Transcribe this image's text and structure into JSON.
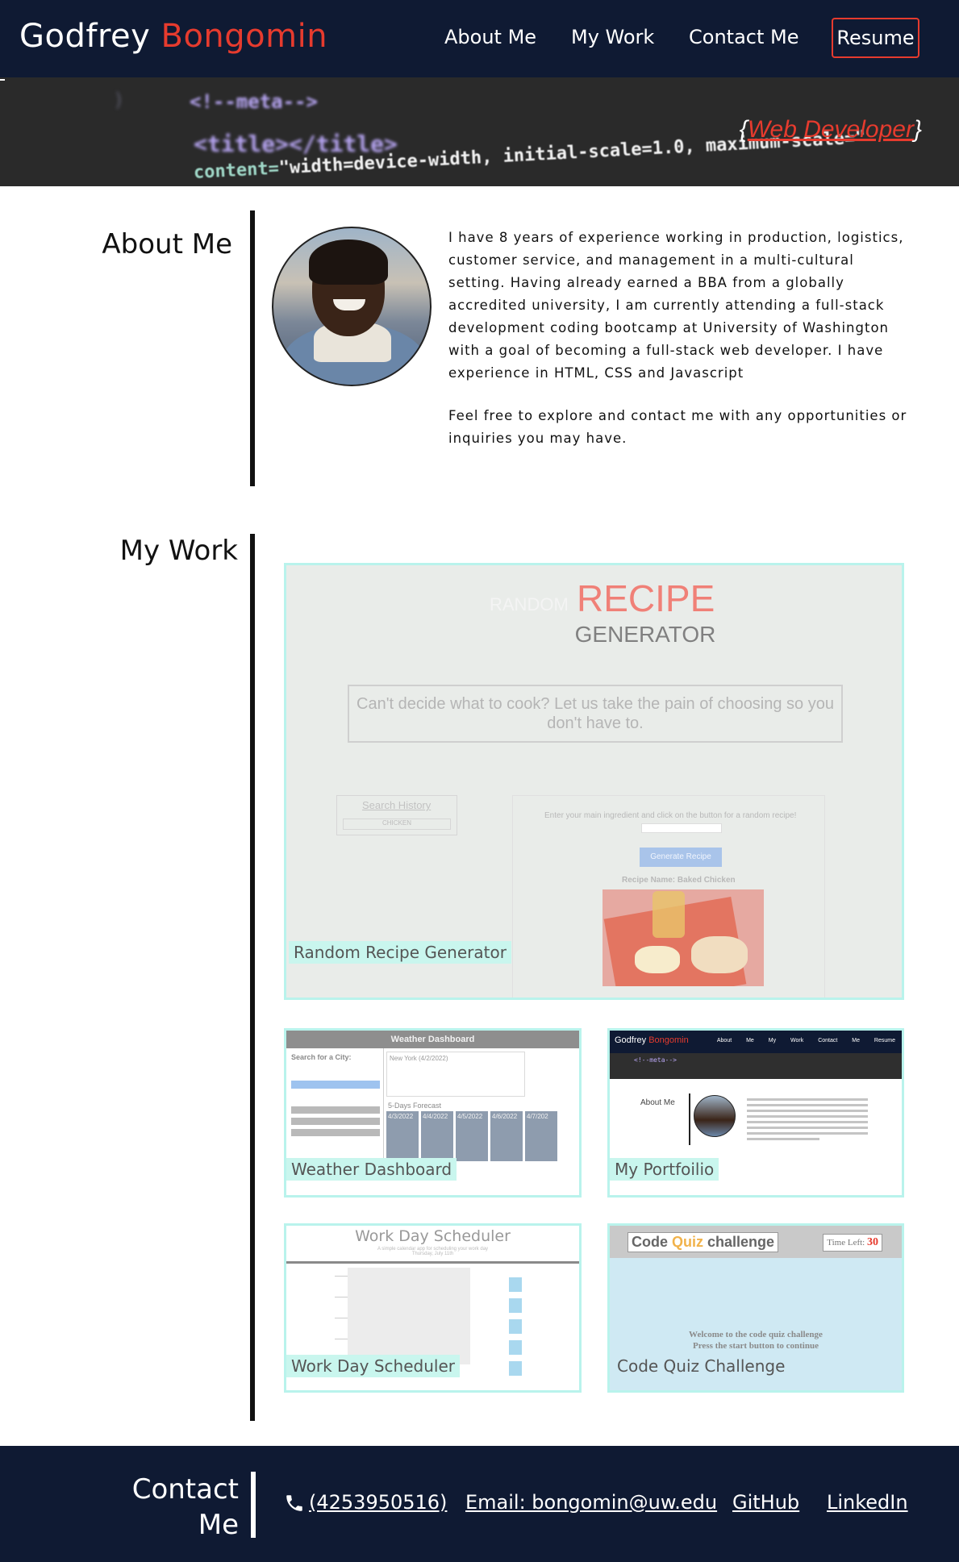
{
  "nav": {
    "brand_first": "Godfrey",
    "brand_last": "Bongomin",
    "links": [
      "About Me",
      "My Work",
      "Contact Me"
    ],
    "resume_label": "Resume"
  },
  "hero": {
    "code_line_1": "<!--meta-->",
    "code_line_2": "<title></title>",
    "code_line_3_attr": "content=",
    "code_line_3_value": "\"width=device-width, initial-scale=1.0, maximum-scale=\"",
    "tagline_open": "{",
    "tagline_text": "Web Developer",
    "tagline_close": "}"
  },
  "about": {
    "title": "About Me",
    "paragraph_1": "I have 8 years of experience working in production, logistics, customer service, and management in a multi-cultural setting. Having already earned a BBA from a globally accredited university, I am currently attending a full-stack development coding bootcamp at University of Washington with a goal of becoming a full-stack web developer. I have experience in HTML, CSS and Javascript",
    "paragraph_2": "Feel free to explore and contact me with any opportunities or inquiries you may have."
  },
  "work": {
    "title": "My Work",
    "projects": [
      {
        "label": "Random Recipe Generator"
      },
      {
        "label": "Weather Dashboard"
      },
      {
        "label": "My Portfoilio"
      },
      {
        "label": "Work Day Scheduler"
      },
      {
        "label": "Code Quiz Challenge"
      }
    ],
    "recipe_preview": {
      "title_small": "RANDOM",
      "title_big": "RECIPE",
      "title_sub": "GENERATOR",
      "intro": "Can't decide what to cook? Let us take the pain of choosing so you don't have to.",
      "history_title": "Search History",
      "history_item": "CHICKEN",
      "prompt": "Enter your main ingredient and click on the button for a random recipe!",
      "button": "Generate Recipe",
      "recipe_name": "Recipe Name: Baked Chicken"
    },
    "weather_preview": {
      "header": "Weather Dashboard",
      "search_label": "Search for a City:",
      "today": "New York (4/2/2022)",
      "forecast_title": "5-Days Forecast",
      "days": [
        "4/3/2022",
        "4/4/2022",
        "4/5/2022",
        "4/6/2022",
        "4/7/202"
      ]
    },
    "portfolio_preview": {
      "brand_first": "Godfrey",
      "brand_last": "Bongomin",
      "links": "About Me My Work Contact Me Resume",
      "about": "About Me"
    },
    "scheduler_preview": {
      "title": "Work Day Scheduler",
      "subtitle": "A simple calendar app for scheduling your work day",
      "date": "Thursday, July 11th"
    },
    "quiz_preview": {
      "title_1": "Code",
      "title_2": "Quiz",
      "title_3": "challenge",
      "time_label": "Time Left:",
      "time_value": "30",
      "welcome_1": "Welcome to the code quiz challenge",
      "welcome_2": "Press the start button to continue"
    }
  },
  "contact": {
    "title_1": "Contact",
    "title_2": "Me",
    "phone": "(4253950516)",
    "email": "Email: bongomin@uw.edu",
    "github": "GitHub",
    "linkedin": "LinkedIn"
  },
  "colors": {
    "navy": "#0f1a33",
    "accent_red": "#e63b2e",
    "card_border": "#b9f3ec"
  }
}
